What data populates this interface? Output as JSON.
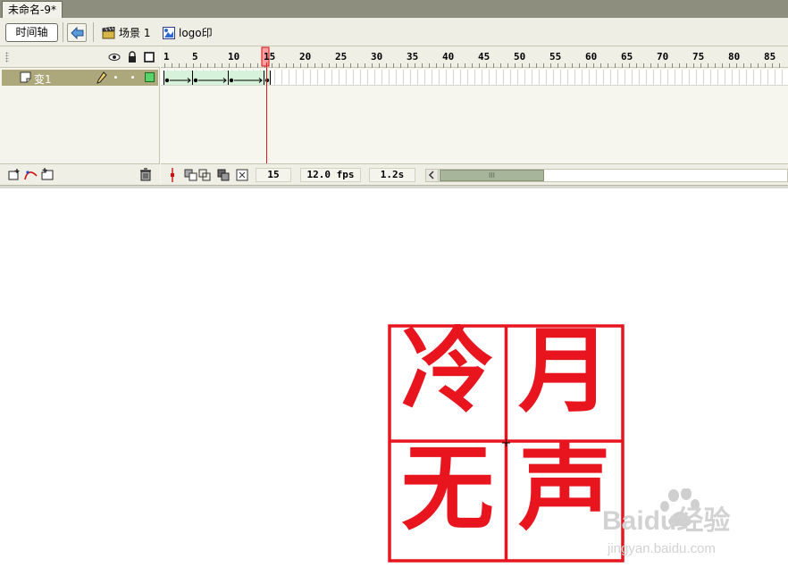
{
  "document": {
    "tab_title": "未命名-9*"
  },
  "editbar": {
    "timeline_label": "时间轴",
    "scene_label": "场景 1",
    "symbol_label": "logo印"
  },
  "timeline": {
    "ruler_ticks": [
      "1",
      "5",
      "10",
      "15",
      "20",
      "25",
      "30",
      "35",
      "40",
      "45",
      "50",
      "55",
      "60",
      "65",
      "70",
      "75",
      "80",
      "85"
    ],
    "current_frame_marker": "15",
    "layer_name": "变1",
    "status": {
      "current_frame": "15",
      "frame_rate": "12.0 fps",
      "elapsed_time": "1.2s"
    },
    "scroll_grip": "III"
  },
  "stage": {
    "seal_characters": [
      "冷",
      "月",
      "无",
      "声"
    ],
    "seal_color": "#e8141e"
  },
  "watermark": {
    "brand": "Baidu经验",
    "url": "jingyan.baidu.com"
  },
  "colors": {
    "layer_selected": "#aca87b",
    "playhead": "#e01a1a",
    "tween": "#d6f2da"
  }
}
